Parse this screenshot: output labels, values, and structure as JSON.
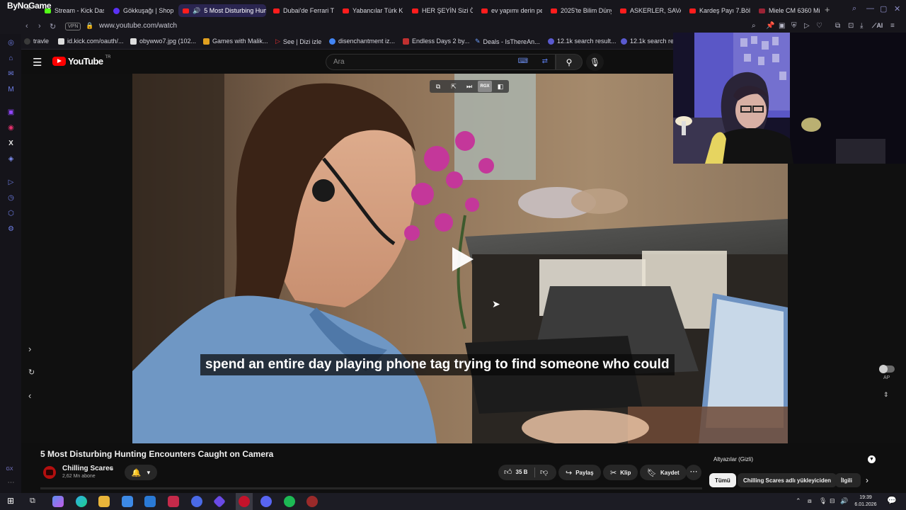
{
  "browser": {
    "brand": "ByNoGame",
    "tabs": [
      {
        "label": "Stream - Kick Das",
        "icon": "kick-favicon"
      },
      {
        "label": "Gökkuşağı | Shop",
        "icon": "shop-favicon"
      },
      {
        "label": "5 Most Disturbing Hun",
        "icon": "youtube-favicon",
        "active": true
      },
      {
        "label": "Dubai'de Ferrari T",
        "icon": "youtube-favicon"
      },
      {
        "label": "Yabancılar Türk K",
        "icon": "youtube-favicon"
      },
      {
        "label": "HER ŞEYİN Sizi Ö",
        "icon": "youtube-favicon"
      },
      {
        "label": "ev yapımı derin pe",
        "icon": "youtube-favicon"
      },
      {
        "label": "2025'te Bilim Düny",
        "icon": "youtube-favicon"
      },
      {
        "label": "ASKERLER, SAVAŞ",
        "icon": "youtube-favicon"
      },
      {
        "label": "Kardeş Payı 7.Bölü",
        "icon": "youtube-favicon"
      },
      {
        "label": "Miele CM 6360 Mi",
        "icon": "miele-favicon"
      }
    ],
    "new_tab": "+",
    "address": {
      "vpn_badge": "VPN",
      "url": "www.youtube.com/watch"
    },
    "extensions_label": "AI",
    "bookmarks": [
      {
        "label": "travle"
      },
      {
        "label": "id.kick.com/oauth/..."
      },
      {
        "label": "obywwo7.jpg (102..."
      },
      {
        "label": "Games with Malik..."
      },
      {
        "label": "See | Dizi izle"
      },
      {
        "label": "disenchantment iz..."
      },
      {
        "label": "Endless Days 2 by..."
      },
      {
        "label": "Deals - IsThereAn..."
      },
      {
        "label": "12.1k search result..."
      },
      {
        "label": "12.1k search results"
      }
    ],
    "sidebar_footer": "GX"
  },
  "youtube": {
    "logo_text": "YouTube",
    "region": "TR",
    "search_placeholder": "Ara",
    "video": {
      "caption": "spend an entire day playing phone tag trying to find someone who could",
      "overlay_badge": "RGX",
      "autoplay_label": "AP"
    },
    "title": "5 Most Disturbing Hunting Encounters Caught on Camera",
    "channel": {
      "name": "Chilling Scares",
      "subscribers": "2,62 Mn abone"
    },
    "actions": {
      "likes": "35 B",
      "share": "Paylaş",
      "clip": "Klip",
      "save": "Kaydet"
    },
    "subtitles_panel": "Altyazılar (Gizli)",
    "chips": [
      "Tümü",
      "Chilling Scares adlı yükleyiciden",
      "İlgili"
    ]
  },
  "taskbar": {
    "time": "19:39",
    "date": "6.01.2026"
  },
  "colors": {
    "accent": "#ff0000",
    "browser_bg": "#17161c",
    "page_bg": "#0f0f0f",
    "active_tab": "#2a2550"
  }
}
